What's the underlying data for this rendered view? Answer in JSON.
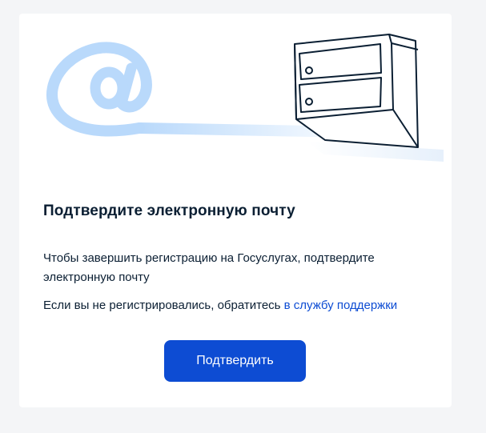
{
  "dialog": {
    "title": "Подтвердите электронную почту",
    "text_line_1": "Чтобы завершить регистрацию на Госуслугах, подтвердите электронную почту",
    "text_line_2_prefix": "Если вы не регистрировались, обратитесь ",
    "support_link": "в службу поддержки",
    "confirm_button": "Подтвердить"
  },
  "illustration": {
    "at_icon": "at-sign-icon",
    "mailbox_icon": "mailbox-illustration"
  },
  "colors": {
    "accent": "#0d4cd3",
    "text": "#0b1f33",
    "at_sign": "#b9d9fb",
    "background": "#f4f5f7",
    "card": "#ffffff"
  }
}
